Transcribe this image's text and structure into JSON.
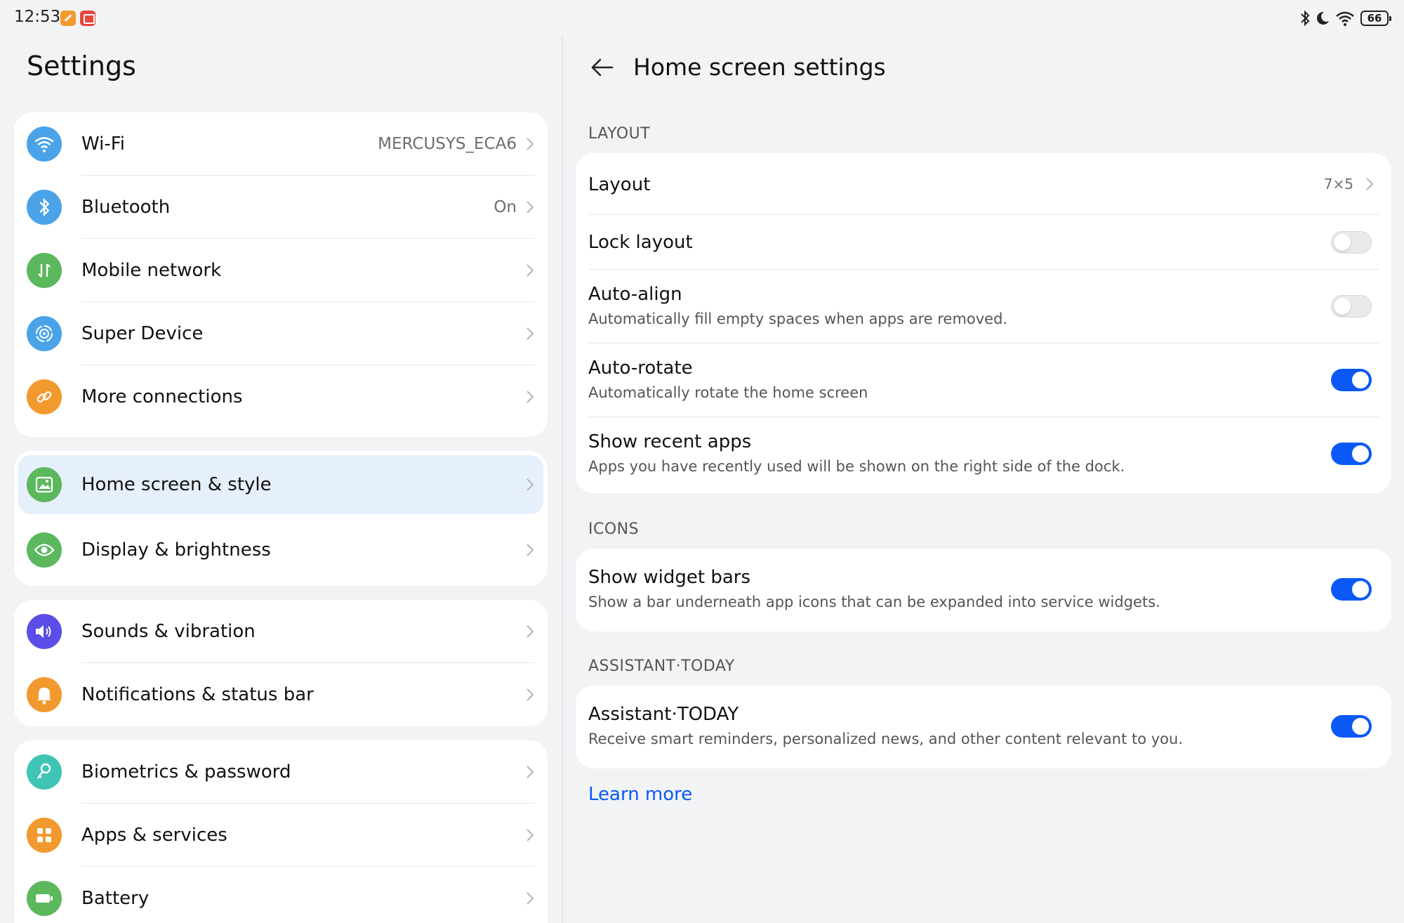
{
  "status_bar": {
    "time": "12:53",
    "battery": "66",
    "icons": [
      "app-notification-icon",
      "app-notification-icon",
      "bluetooth-icon",
      "moon-icon",
      "wifi-icon",
      "battery-icon"
    ]
  },
  "left": {
    "title": "Settings",
    "groups": [
      {
        "items": [
          {
            "label": "Wi-Fi",
            "value": "MERCUSYS_ECA6",
            "icon": "wifi-icon",
            "color": "#4aa3e8"
          },
          {
            "label": "Bluetooth",
            "value": "On",
            "icon": "bluetooth-icon",
            "color": "#4aa3e8"
          },
          {
            "label": "Mobile network",
            "value": "",
            "icon": "mobile-data-icon",
            "color": "#5bb85d"
          },
          {
            "label": "Super Device",
            "value": "",
            "icon": "super-device-icon",
            "color": "#4aa3e8"
          },
          {
            "label": "More connections",
            "value": "",
            "icon": "link-icon",
            "color": "#f29a2e"
          }
        ]
      },
      {
        "items": [
          {
            "label": "Home screen & style",
            "value": "",
            "icon": "image-icon",
            "color": "#5bb85d",
            "selected": true
          },
          {
            "label": "Display & brightness",
            "value": "",
            "icon": "eye-icon",
            "color": "#5bb85d"
          }
        ]
      },
      {
        "items": [
          {
            "label": "Sounds & vibration",
            "value": "",
            "icon": "speaker-icon",
            "color": "#5b4de8"
          },
          {
            "label": "Notifications & status bar",
            "value": "",
            "icon": "bell-icon",
            "color": "#f29a2e"
          }
        ]
      },
      {
        "items": [
          {
            "label": "Biometrics & password",
            "value": "",
            "icon": "key-icon",
            "color": "#3fc4b5"
          },
          {
            "label": "Apps & services",
            "value": "",
            "icon": "apps-icon",
            "color": "#f29a2e"
          },
          {
            "label": "Battery",
            "value": "",
            "icon": "battery-icon",
            "color": "#5bb85d"
          }
        ]
      }
    ]
  },
  "right": {
    "title": "Home screen settings",
    "sections": {
      "layout": {
        "header": "LAYOUT",
        "rows": [
          {
            "title": "Layout",
            "value": "7×5"
          },
          {
            "title": "Lock layout",
            "toggle": "off"
          },
          {
            "title": "Auto-align",
            "subtitle": "Automatically fill empty spaces when apps are removed.",
            "toggle": "off"
          },
          {
            "title": "Auto-rotate",
            "subtitle": "Automatically rotate the home screen",
            "toggle": "on"
          },
          {
            "title": "Show recent apps",
            "subtitle": "Apps you have recently used will be shown on the right side of the dock.",
            "toggle": "on"
          }
        ]
      },
      "icons": {
        "header": "ICONS",
        "rows": [
          {
            "title": "Show widget bars",
            "subtitle": "Show a bar underneath app icons that can be expanded into service widgets.",
            "toggle": "on"
          }
        ]
      },
      "assistant": {
        "header": "ASSISTANT·TODAY",
        "rows": [
          {
            "title": "Assistant·TODAY",
            "subtitle": "Receive smart reminders, personalized news, and other content relevant to you.",
            "toggle": "on"
          }
        ]
      }
    },
    "learn_more": "Learn more"
  },
  "colors": {
    "accent": "#0a59f7",
    "background": "#f1f3f5",
    "selected": "#e6effc"
  }
}
